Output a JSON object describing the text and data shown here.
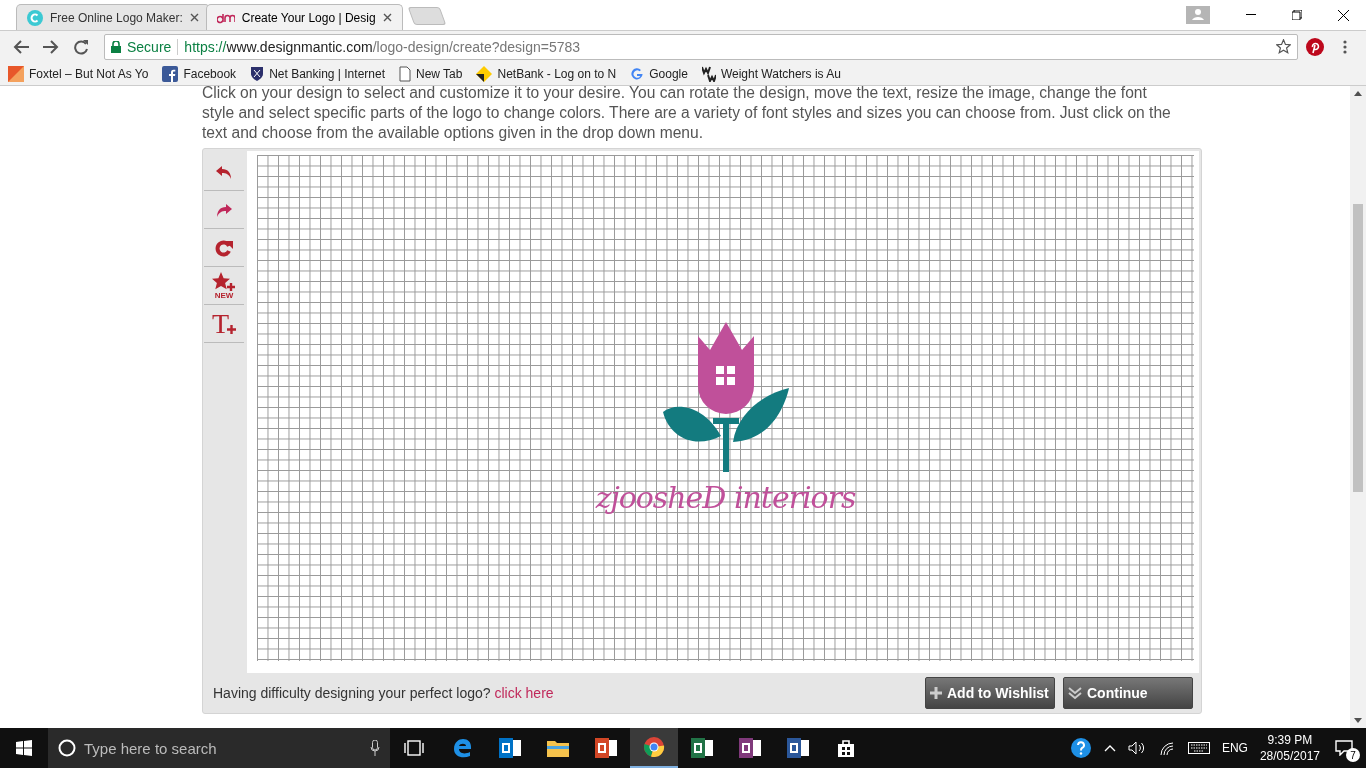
{
  "browser": {
    "tabs": [
      {
        "title": "Free Online Logo Maker:",
        "selected": false
      },
      {
        "title": "Create Your Logo | Desig",
        "selected": true
      }
    ],
    "address": {
      "secure_label": "Secure",
      "url_scheme": "https://",
      "url_host": "www.designmantic.com",
      "url_path": "/logo-design/create?design=5783"
    },
    "bookmarks": [
      {
        "label": "Foxtel – But Not As Yo",
        "kind": "foxtel"
      },
      {
        "label": "Facebook",
        "kind": "facebook"
      },
      {
        "label": "Net Banking | Internet",
        "kind": "shield"
      },
      {
        "label": "New Tab",
        "kind": "page"
      },
      {
        "label": "NetBank - Log on to N",
        "kind": "diamond"
      },
      {
        "label": "Google",
        "kind": "google"
      },
      {
        "label": "Weight Watchers is Au",
        "kind": "ww"
      }
    ]
  },
  "page": {
    "intro": "Click on your design to select and customize it to your desire. You can rotate the design, move the text, resize the image, change the font style and select specific parts of the logo to change colors. There are a variety of font styles and sizes you can choose from. Just click on the text and choose from the available options given in the drop down menu.",
    "tools": [
      {
        "kind": "undo"
      },
      {
        "kind": "redo"
      },
      {
        "kind": "rotate"
      },
      {
        "kind": "new-symbol",
        "label": "NEW"
      },
      {
        "kind": "add-text",
        "glyph": "T"
      }
    ],
    "logo_text": "zjoosheD interiors",
    "help_text": "Having difficulty designing your perfect logo?",
    "help_link": "click here",
    "buttons": [
      {
        "label": "Add to Wishlist",
        "kind": "add"
      },
      {
        "label": "Continue",
        "kind": "continue"
      }
    ]
  },
  "taskbar": {
    "search_placeholder": "Type here to search",
    "apps": [
      {
        "kind": "task-view",
        "selected": false
      },
      {
        "kind": "edge",
        "selected": false
      },
      {
        "kind": "outlook",
        "selected": false
      },
      {
        "kind": "folder",
        "selected": false
      },
      {
        "kind": "powerpoint",
        "selected": false
      },
      {
        "kind": "chrome",
        "selected": true
      },
      {
        "kind": "excel",
        "selected": false
      },
      {
        "kind": "onenote",
        "selected": false
      },
      {
        "kind": "word",
        "selected": false
      },
      {
        "kind": "store",
        "selected": false
      }
    ],
    "language": "ENG",
    "time": "9:39 PM",
    "date": "28/05/2017",
    "notification_count": "7"
  }
}
